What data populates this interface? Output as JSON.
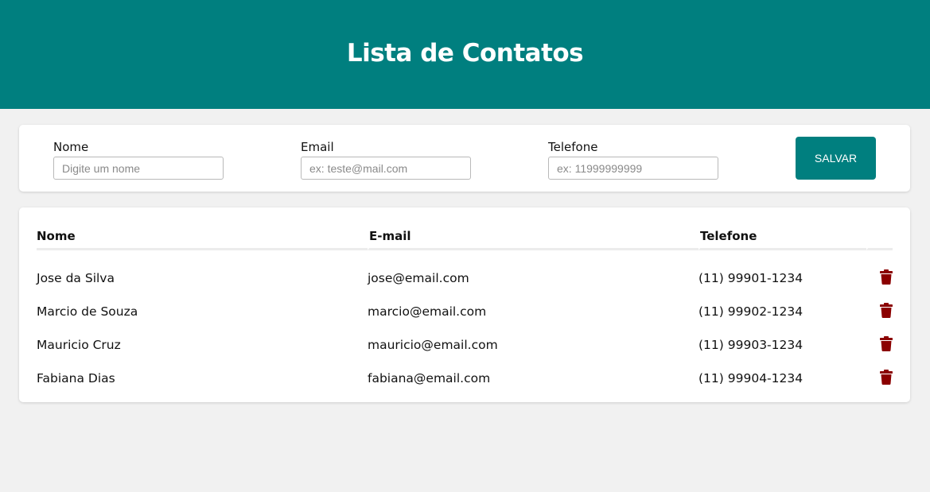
{
  "header": {
    "title": "Lista de Contatos"
  },
  "colors": {
    "accent": "#007f7f",
    "delete": "#8b0000",
    "background": "#f1f1f1"
  },
  "form": {
    "nome": {
      "label": "Nome",
      "placeholder": "Digite um nome",
      "value": ""
    },
    "email": {
      "label": "Email",
      "placeholder": "ex: teste@mail.com",
      "value": ""
    },
    "telefone": {
      "label": "Telefone",
      "placeholder": "ex: 11999999999",
      "value": ""
    },
    "save_label": "SALVAR"
  },
  "table": {
    "columns": [
      "Nome",
      "E-mail",
      "Telefone",
      ""
    ],
    "rows": [
      {
        "nome": "Jose da Silva",
        "email": "jose@email.com",
        "telefone": "(11) 99901-1234",
        "icon": "trash-icon"
      },
      {
        "nome": "Marcio de Souza",
        "email": "marcio@email.com",
        "telefone": "(11) 99902-1234",
        "icon": "trash-icon"
      },
      {
        "nome": "Mauricio Cruz",
        "email": "mauricio@email.com",
        "telefone": "(11) 99903-1234",
        "icon": "trash-icon"
      },
      {
        "nome": "Fabiana Dias",
        "email": "fabiana@email.com",
        "telefone": "(11) 99904-1234",
        "icon": "trash-icon"
      }
    ]
  }
}
